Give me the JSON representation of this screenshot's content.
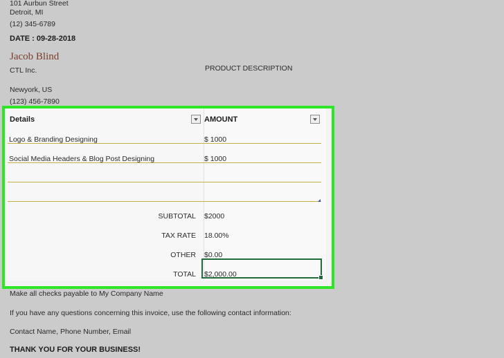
{
  "sender": {
    "street": "101 Aurbun Street",
    "city": "Detroit, MI",
    "phone": "(12) 345-6789"
  },
  "date_line": "DATE : 09-28-2018",
  "client": {
    "name": "Jacob Blind",
    "company": "CTL Inc.",
    "city": "Newyork, US",
    "phone": "(123) 456-7890"
  },
  "product_description_label": "PRODUCT DESCRIPTION",
  "table": {
    "col_details": "Details",
    "col_amount": "AMOUNT",
    "rows": [
      {
        "details": "Logo & Branding Designing",
        "amount": "$ 1000"
      },
      {
        "details": "Social Media Headers & Blog Post Designing",
        "amount": "$ 1000"
      },
      {
        "details": "",
        "amount": ""
      },
      {
        "details": "",
        "amount": ""
      }
    ],
    "summary": {
      "subtotal_label": "SUBTOTAL",
      "subtotal_value": "$2000",
      "tax_label": "TAX RATE",
      "tax_value": "18.00%",
      "other_label": "OTHER",
      "other_value": "$0.00",
      "total_label": "TOTAL",
      "total_value": "$2,000.00"
    }
  },
  "footer": {
    "checks_note": "Make all checks payable to My Company Name",
    "questions_note": "If you have any questions concerning this invoice, use the following contact information:",
    "contact_line": "Contact Name, Phone Number, Email",
    "thanks": "THANK YOU FOR YOUR BUSINESS!"
  },
  "colors": {
    "highlight_border": "#2fe626",
    "row_rule": "#c5b048",
    "selection": "#1f6b3a",
    "client_name": "#7a3e2c"
  }
}
